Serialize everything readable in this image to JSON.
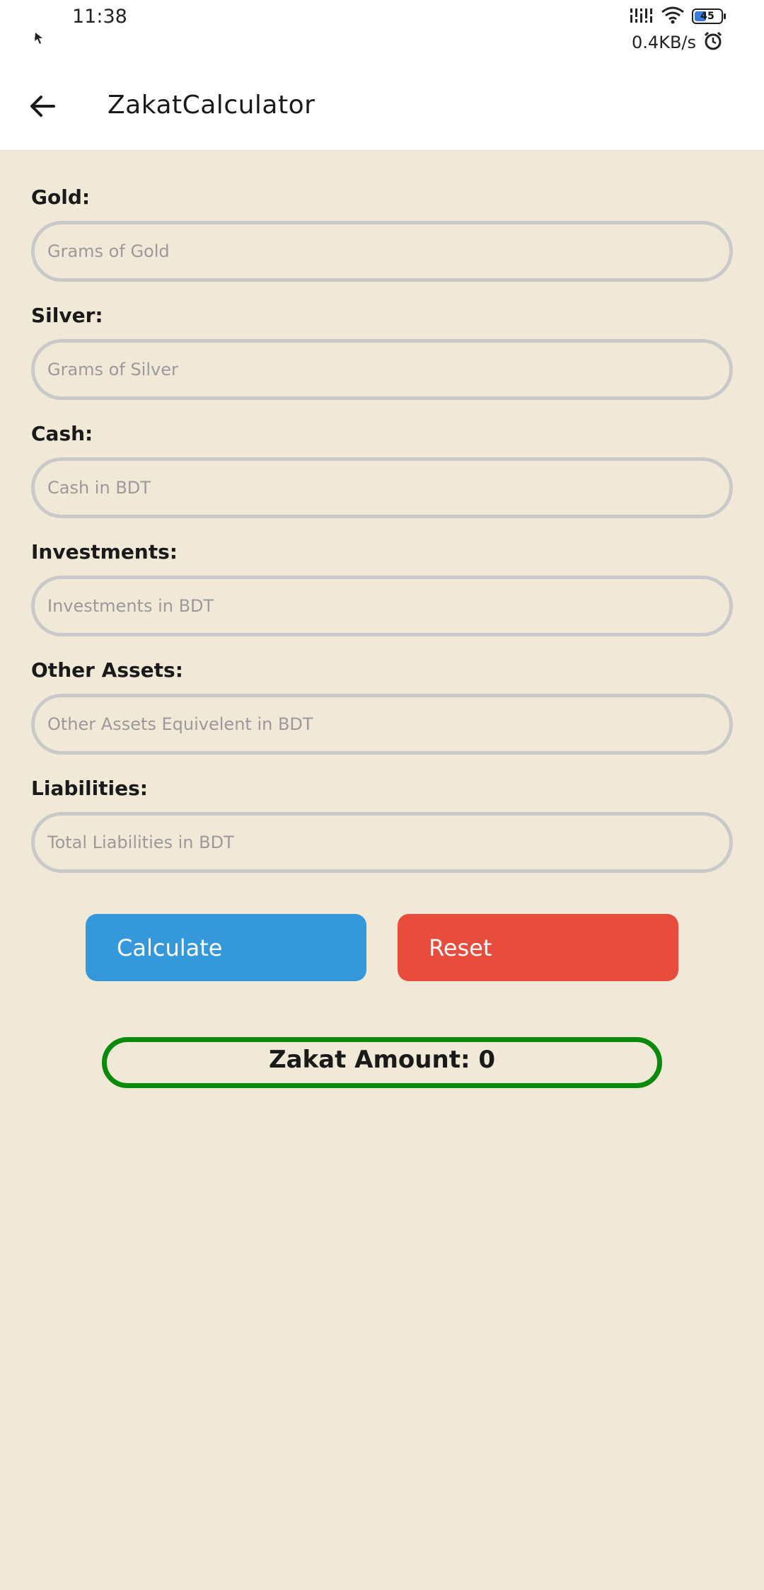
{
  "status_bar": {
    "time": "11:38",
    "network_speed": "0.4KB/s",
    "battery_level": "45",
    "battery_fill": 0.45,
    "icons": [
      "signal-icon",
      "wifi-icon",
      "battery-icon",
      "alarm-icon",
      "notification-icon"
    ]
  },
  "app_bar": {
    "title": "ZakatCalculator",
    "back_icon": "back-arrow-icon"
  },
  "form": {
    "fields": [
      {
        "label": "Gold:",
        "placeholder": "Grams of Gold",
        "value": ""
      },
      {
        "label": "Silver:",
        "placeholder": "Grams of Silver",
        "value": ""
      },
      {
        "label": "Cash:",
        "placeholder": "Cash in BDT",
        "value": ""
      },
      {
        "label": "Investments:",
        "placeholder": "Investments in BDT",
        "value": ""
      },
      {
        "label": "Other Assets:",
        "placeholder": "Other Assets Equivelent in BDT",
        "value": ""
      },
      {
        "label": "Liabilities:",
        "placeholder": "Total Liabilities in BDT",
        "value": ""
      }
    ]
  },
  "actions": {
    "calculate_label": "Calculate",
    "reset_label": "Reset",
    "calculate_color": "#3498db",
    "reset_color": "#e74c3c"
  },
  "result": {
    "text": "Zakat Amount: 0",
    "border_color": "#0a8a0a"
  },
  "theme": {
    "background": "#f0e9d8"
  }
}
